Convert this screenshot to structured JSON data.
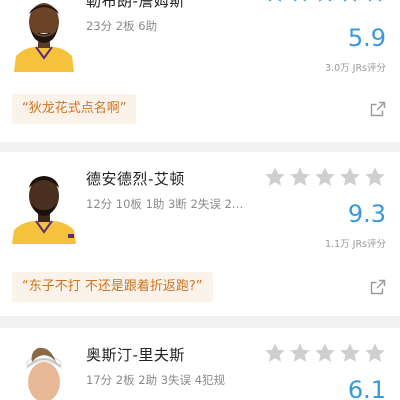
{
  "colors": {
    "accent_blue": "#3a9ad9",
    "star_active": "#3a9ad9",
    "star_inactive": "#cfcfcf",
    "comment_text": "#d0731f",
    "comment_bg": "#fbf3ea",
    "lakers_gold": "#f5c33b"
  },
  "players": [
    {
      "name": "勒布朗-詹姆斯",
      "stats": "23分 2板 6助",
      "stars_filled": 5,
      "score": "5.9",
      "votes": "3.0万 JRs评分",
      "comment": "“狄龙花式点名啊”",
      "avatar_icon": "player-headshot",
      "share_icon": "share-icon"
    },
    {
      "name": "德安德烈-艾顿",
      "stats": "12分 10板 1助 3断 2失误 2…",
      "stars_filled": 0,
      "score": "9.3",
      "votes": "1.1万 JRs评分",
      "comment": "“东子不打 不还是跟着折返跑?”",
      "avatar_icon": "player-headshot",
      "share_icon": "share-icon"
    },
    {
      "name": "奥斯汀-里夫斯",
      "stats": "17分 2板 2助 3失误 4犯规",
      "stars_filled": 0,
      "score": "6.1",
      "avatar_icon": "player-headshot"
    }
  ]
}
